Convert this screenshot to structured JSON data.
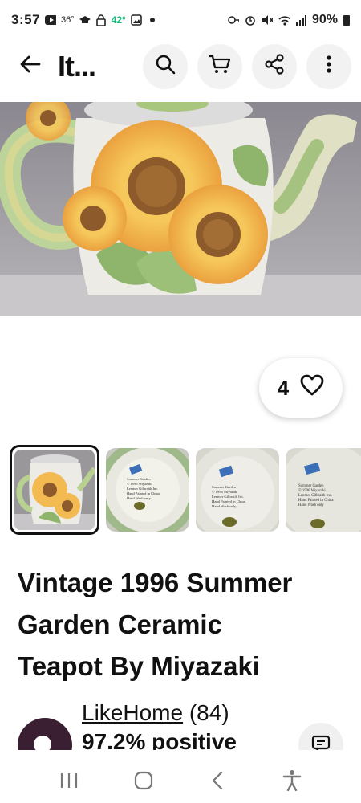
{
  "status_bar": {
    "time": "3:57",
    "indicators": "36°",
    "temperature": "42°",
    "battery": "90%",
    "icons": [
      "youtube-icon",
      "graduation-cap-icon",
      "lock-icon",
      "image-icon",
      "dot-icon",
      "key-icon",
      "alarm-icon",
      "mute-icon",
      "wifi-icon",
      "signal-icon",
      "battery-icon"
    ]
  },
  "header": {
    "title": "It...",
    "icons": [
      "back-arrow-icon",
      "search-icon",
      "cart-icon",
      "share-icon",
      "more-vertical-icon"
    ]
  },
  "like": {
    "count": "4",
    "icon": "heart-icon"
  },
  "gallery": {
    "thumbnails": [
      {
        "name": "teapot-front"
      },
      {
        "name": "teapot-bottom-label"
      },
      {
        "name": "teapot-bottom-label-2"
      },
      {
        "name": "teapot-bottom-label-3"
      }
    ],
    "label_lines": [
      "Summer Garden",
      "© 1996 Miyazaki",
      "Lenmer Gilbraith Inc.",
      "Hand Painted in China",
      "Hand Wash only"
    ]
  },
  "item": {
    "title_lines": [
      "Vintage 1996 Summer",
      "Garden Ceramic",
      "Teapot By Miyazaki"
    ]
  },
  "seller": {
    "name": "LikeHome",
    "count": "(84)",
    "feedback": "97.2% positive"
  },
  "nav": {
    "icons": [
      "recent-apps-icon",
      "home-icon",
      "back-icon",
      "accessibility-icon"
    ]
  },
  "colors": {
    "accent": "#111111",
    "sunflower": "#f0b548",
    "leaf": "#8fb56c",
    "temperature": "#11bb77"
  }
}
